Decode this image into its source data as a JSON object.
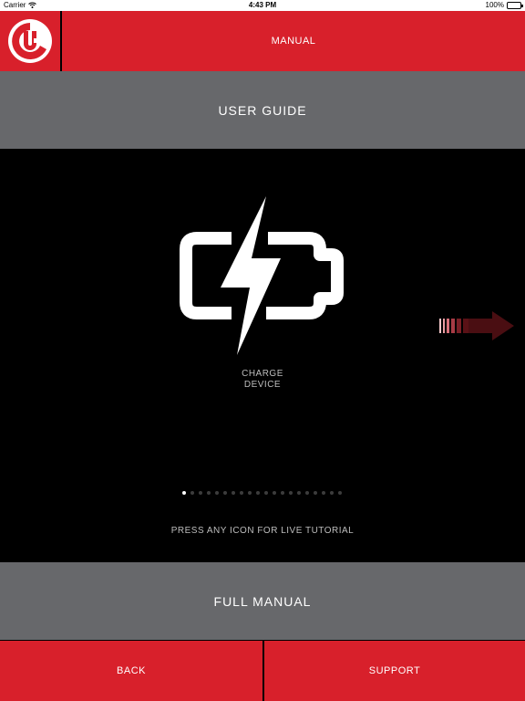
{
  "status_bar": {
    "carrier": "Carrier",
    "time": "4:43 PM",
    "battery": "100%",
    "wifi_icon": "wifi-icon",
    "battery_icon": "battery-full-icon"
  },
  "header": {
    "logo_icon": "brand-logo-icon",
    "title": "MANUAL"
  },
  "guide_bar": {
    "label": "USER GUIDE"
  },
  "tutorial": {
    "step_label_line1": "CHARGE",
    "step_label_line2": "DEVICE",
    "step_icon": "charging-battery-icon",
    "next_icon": "next-arrow-icon",
    "page_count": 20,
    "current_page": 1,
    "hint": "PRESS ANY ICON FOR LIVE TUTORIAL"
  },
  "manual_bar": {
    "label": "FULL MANUAL"
  },
  "footer": {
    "back_label": "BACK",
    "support_label": "SUPPORT"
  },
  "colors": {
    "brand_red": "#d8202b",
    "bar_gray": "#67686b",
    "background": "#000000",
    "text": "#ffffff"
  }
}
